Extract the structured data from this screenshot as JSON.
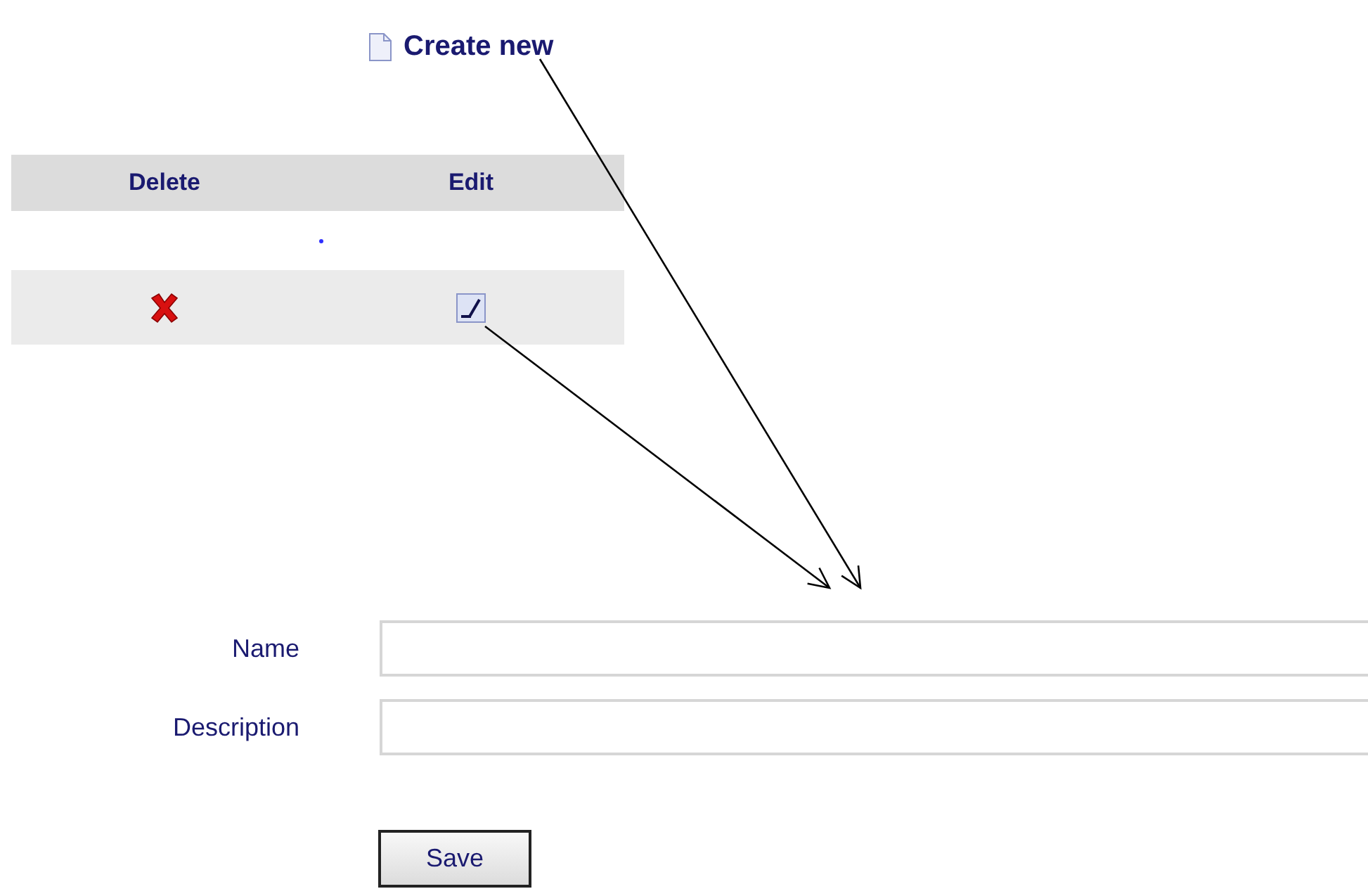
{
  "create_link": {
    "label": "Create new"
  },
  "table": {
    "columns": [
      "Delete",
      "Edit"
    ],
    "rows": [
      {
        "kind": "blank"
      },
      {
        "kind": "actions"
      }
    ]
  },
  "form": {
    "fields": [
      {
        "label": "Name"
      },
      {
        "label": "Description"
      }
    ],
    "submit": "Save"
  },
  "annotations": [
    {
      "kind": "arrow"
    },
    {
      "kind": "arrow"
    }
  ]
}
